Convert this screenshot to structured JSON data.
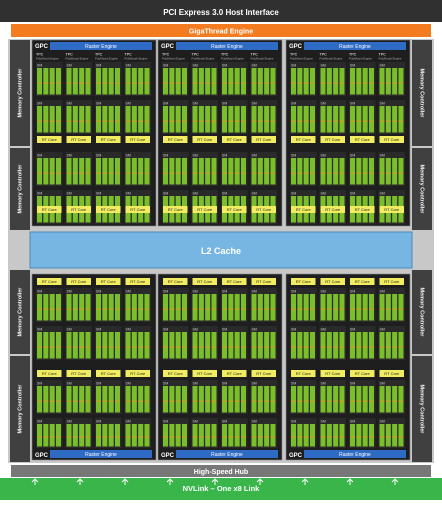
{
  "header": {
    "pcie_label": "PCI Express 3.0 Host Interface",
    "gigathread_label": "GigaThread Engine"
  },
  "memory_controller_label": "Memory Controller",
  "gpc_label": "GPC",
  "raster_engine_label": "Raster Engine",
  "tpc_label": "TPC",
  "polymorph_label": "PolyMorph Engine",
  "sm_label": "SM",
  "rt_core_label": "RT Core",
  "l2_cache_label": "L2 Cache",
  "high_speed_hub_label": "High-Speed Hub",
  "nvlink_label": "NVLink – One x8 Link",
  "colors": {
    "pcie_bar": "#303030",
    "gigathread": "#f47c20",
    "die_frame": "#c8c8c8",
    "memory_controller": "#404040",
    "gpc_background": "#1e1e1e",
    "raster_engine": "#2d6bc4",
    "rt_core": "#f2ec60",
    "sm_green": "#7abf2a",
    "l2_cache": "#77b6e3",
    "high_speed_hub": "#777777",
    "nvlink": "#39b54a"
  }
}
